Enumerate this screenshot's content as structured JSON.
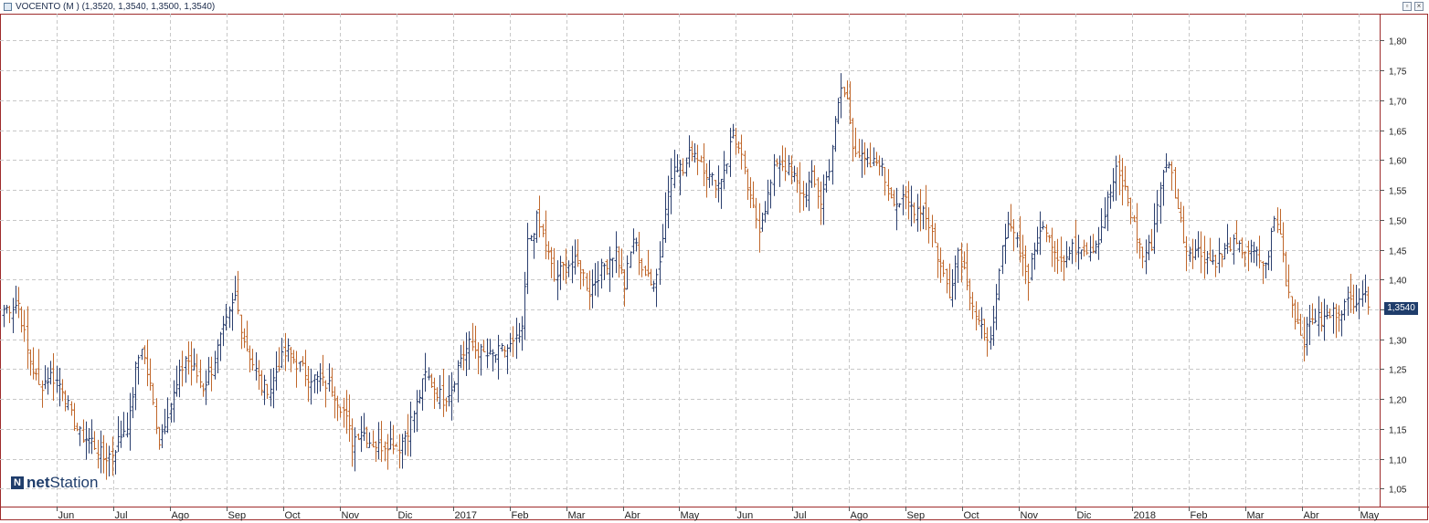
{
  "window": {
    "title": "VOCENTO (M ) (1,3520, 1,3540, 1,3500, 1,3540)",
    "buttons": [
      "restore",
      "close"
    ]
  },
  "brand": {
    "mark": "N",
    "net": "net",
    "station": "Station"
  },
  "last_price_label": "1,3540",
  "colors": {
    "up": "#2b3f6e",
    "down": "#c0672b",
    "frame": "#9e2b2b",
    "grid": "#c8c8c8",
    "price_tag": "#1f3d6b"
  },
  "chart_data": {
    "type": "ohlc",
    "title": "VOCENTO (M )",
    "xlabel": "",
    "ylabel": "",
    "ylim": [
      1.02,
      1.845
    ],
    "yticks": [
      1.05,
      1.1,
      1.15,
      1.2,
      1.25,
      1.3,
      1.35,
      1.4,
      1.45,
      1.5,
      1.55,
      1.6,
      1.65,
      1.7,
      1.75,
      1.8
    ],
    "ytick_labels": [
      "1,05",
      "1,10",
      "1,15",
      "1,20",
      "1,25",
      "1,30",
      "1,35",
      "1,40",
      "1,45",
      "1,50",
      "1,55",
      "1,60",
      "1,65",
      "1,70",
      "1,75",
      "1,80"
    ],
    "xtick_labels": [
      "Jun",
      "Jul",
      "Ago",
      "Sep",
      "Oct",
      "Nov",
      "Dic",
      "2017",
      "Feb",
      "Mar",
      "Abr",
      "May",
      "Jun",
      "Jul",
      "Ago",
      "Sep",
      "Oct",
      "Nov",
      "Dic",
      "2018",
      "Feb",
      "Mar",
      "Abr",
      "May"
    ],
    "last_value": 1.354,
    "grid": true,
    "anchors": [
      [
        0,
        1.35
      ],
      [
        5,
        1.36
      ],
      [
        8,
        1.28
      ],
      [
        12,
        1.22
      ],
      [
        16,
        1.24
      ],
      [
        20,
        1.22
      ],
      [
        23,
        1.17
      ],
      [
        26,
        1.14
      ],
      [
        30,
        1.13
      ],
      [
        34,
        1.1
      ],
      [
        37,
        1.11
      ],
      [
        40,
        1.14
      ],
      [
        43,
        1.17
      ],
      [
        45,
        1.25
      ],
      [
        47,
        1.29
      ],
      [
        50,
        1.22
      ],
      [
        53,
        1.13
      ],
      [
        56,
        1.18
      ],
      [
        59,
        1.22
      ],
      [
        62,
        1.27
      ],
      [
        65,
        1.25
      ],
      [
        68,
        1.22
      ],
      [
        71,
        1.25
      ],
      [
        74,
        1.3
      ],
      [
        77,
        1.34
      ],
      [
        79,
        1.37
      ],
      [
        82,
        1.3
      ],
      [
        85,
        1.26
      ],
      [
        88,
        1.22
      ],
      [
        91,
        1.22
      ],
      [
        94,
        1.26
      ],
      [
        97,
        1.28
      ],
      [
        100,
        1.26
      ],
      [
        104,
        1.24
      ],
      [
        108,
        1.23
      ],
      [
        112,
        1.22
      ],
      [
        116,
        1.18
      ],
      [
        119,
        1.13
      ],
      [
        122,
        1.15
      ],
      [
        125,
        1.13
      ],
      [
        128,
        1.12
      ],
      [
        132,
        1.13
      ],
      [
        135,
        1.12
      ],
      [
        138,
        1.15
      ],
      [
        141,
        1.19
      ],
      [
        144,
        1.24
      ],
      [
        147,
        1.22
      ],
      [
        150,
        1.2
      ],
      [
        153,
        1.22
      ],
      [
        156,
        1.27
      ],
      [
        159,
        1.29
      ],
      [
        162,
        1.28
      ],
      [
        166,
        1.27
      ],
      [
        170,
        1.28
      ],
      [
        174,
        1.29
      ],
      [
        177,
        1.31
      ],
      [
        179,
        1.46
      ],
      [
        182,
        1.5
      ],
      [
        185,
        1.46
      ],
      [
        188,
        1.4
      ],
      [
        191,
        1.42
      ],
      [
        194,
        1.43
      ],
      [
        197,
        1.42
      ],
      [
        200,
        1.38
      ],
      [
        203,
        1.41
      ],
      [
        206,
        1.43
      ],
      [
        209,
        1.45
      ],
      [
        212,
        1.39
      ],
      [
        215,
        1.47
      ],
      [
        218,
        1.42
      ],
      [
        221,
        1.39
      ],
      [
        224,
        1.43
      ],
      [
        226,
        1.52
      ],
      [
        229,
        1.6
      ],
      [
        232,
        1.58
      ],
      [
        235,
        1.62
      ],
      [
        238,
        1.6
      ],
      [
        241,
        1.57
      ],
      [
        244,
        1.56
      ],
      [
        247,
        1.6
      ],
      [
        249,
        1.65
      ],
      [
        252,
        1.6
      ],
      [
        255,
        1.53
      ],
      [
        258,
        1.49
      ],
      [
        261,
        1.54
      ],
      [
        264,
        1.6
      ],
      [
        267,
        1.59
      ],
      [
        270,
        1.57
      ],
      [
        273,
        1.54
      ],
      [
        276,
        1.57
      ],
      [
        279,
        1.53
      ],
      [
        282,
        1.59
      ],
      [
        284,
        1.66
      ],
      [
        286,
        1.72
      ],
      [
        288,
        1.7
      ],
      [
        290,
        1.63
      ],
      [
        293,
        1.6
      ],
      [
        296,
        1.59
      ],
      [
        299,
        1.6
      ],
      [
        302,
        1.55
      ],
      [
        305,
        1.53
      ],
      [
        308,
        1.53
      ],
      [
        311,
        1.52
      ],
      [
        314,
        1.52
      ],
      [
        317,
        1.48
      ],
      [
        320,
        1.42
      ],
      [
        323,
        1.38
      ],
      [
        326,
        1.45
      ],
      [
        329,
        1.4
      ],
      [
        332,
        1.34
      ],
      [
        335,
        1.3
      ],
      [
        338,
        1.32
      ],
      [
        341,
        1.45
      ],
      [
        344,
        1.5
      ],
      [
        347,
        1.45
      ],
      [
        350,
        1.4
      ],
      [
        353,
        1.47
      ],
      [
        356,
        1.49
      ],
      [
        359,
        1.45
      ],
      [
        362,
        1.43
      ],
      [
        365,
        1.45
      ],
      [
        368,
        1.46
      ],
      [
        371,
        1.45
      ],
      [
        374,
        1.47
      ],
      [
        377,
        1.53
      ],
      [
        380,
        1.58
      ],
      [
        383,
        1.55
      ],
      [
        386,
        1.49
      ],
      [
        389,
        1.44
      ],
      [
        392,
        1.46
      ],
      [
        395,
        1.56
      ],
      [
        398,
        1.6
      ],
      [
        401,
        1.52
      ],
      [
        404,
        1.45
      ],
      [
        407,
        1.45
      ],
      [
        410,
        1.44
      ],
      [
        413,
        1.43
      ],
      [
        416,
        1.44
      ],
      [
        419,
        1.46
      ],
      [
        422,
        1.45
      ],
      [
        425,
        1.45
      ],
      [
        428,
        1.44
      ],
      [
        431,
        1.42
      ],
      [
        434,
        1.5
      ],
      [
        436,
        1.48
      ],
      [
        438,
        1.4
      ],
      [
        441,
        1.34
      ],
      [
        444,
        1.3
      ],
      [
        447,
        1.34
      ],
      [
        450,
        1.33
      ],
      [
        453,
        1.34
      ],
      [
        456,
        1.35
      ],
      [
        459,
        1.36
      ],
      [
        462,
        1.37
      ],
      [
        464,
        1.38
      ],
      [
        466,
        1.354
      ]
    ]
  }
}
